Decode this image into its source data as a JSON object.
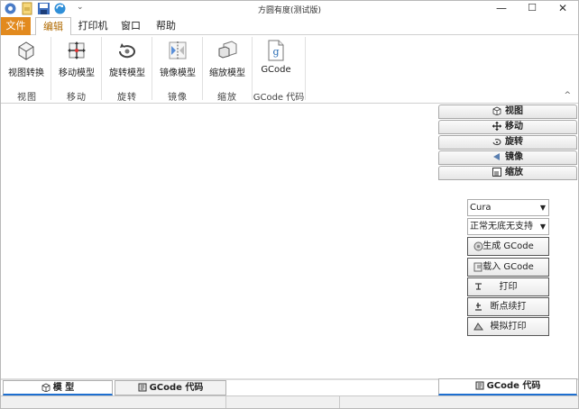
{
  "window": {
    "title": "方圆有度(测试版)",
    "minimize": "—",
    "maximize": "☐",
    "close": "✕"
  },
  "quick_access": [
    "app-logo-icon",
    "open-icon",
    "save-icon",
    "refresh-icon"
  ],
  "quick_access_dropdown": "⌄",
  "menu": {
    "file": "文件",
    "edit": "编辑",
    "printer": "打印机",
    "window": "窗口",
    "help": "帮助"
  },
  "ribbon": {
    "buttons": [
      {
        "label": "视图转换",
        "icon": "cube-view-icon"
      },
      {
        "label": "移动模型",
        "icon": "move-icon"
      },
      {
        "label": "旋转模型",
        "icon": "rotate-icon"
      },
      {
        "label": "镜像模型",
        "icon": "mirror-icon"
      },
      {
        "label": "缩放模型",
        "icon": "scale-icon"
      },
      {
        "label": "GCode",
        "icon": "gcode-file-icon"
      }
    ],
    "groups": [
      "视图",
      "移动",
      "旋转",
      "镜像",
      "缩放",
      "GCode 代码"
    ],
    "collapse": "^"
  },
  "right_panel": {
    "tabs": [
      {
        "label": "视图",
        "icon": "cube-icon"
      },
      {
        "label": "移动",
        "icon": "move-arrows-icon"
      },
      {
        "label": "旋转",
        "icon": "rotate-icon"
      },
      {
        "label": "镜像",
        "icon": "mirror-icon"
      },
      {
        "label": "缩放",
        "icon": "scale-icon"
      }
    ],
    "slicer_select": "Cura",
    "mode_select": "正常无底无支持",
    "actions": [
      {
        "label": "生成 GCode",
        "icon": "generate-icon"
      },
      {
        "label": "载入 GCode",
        "icon": "load-icon"
      },
      {
        "label": "打印",
        "icon": "print-icon"
      },
      {
        "label": "断点续打",
        "icon": "resume-icon"
      },
      {
        "label": "模拟打印",
        "icon": "simulate-icon"
      }
    ]
  },
  "bottom_tabs": {
    "model": "模 型",
    "gcode_left": "GCode 代码",
    "gcode_right": "GCode 代码"
  },
  "colors": {
    "file_menu": "#e28a1e",
    "accent_tab": "#1e6fd0"
  }
}
